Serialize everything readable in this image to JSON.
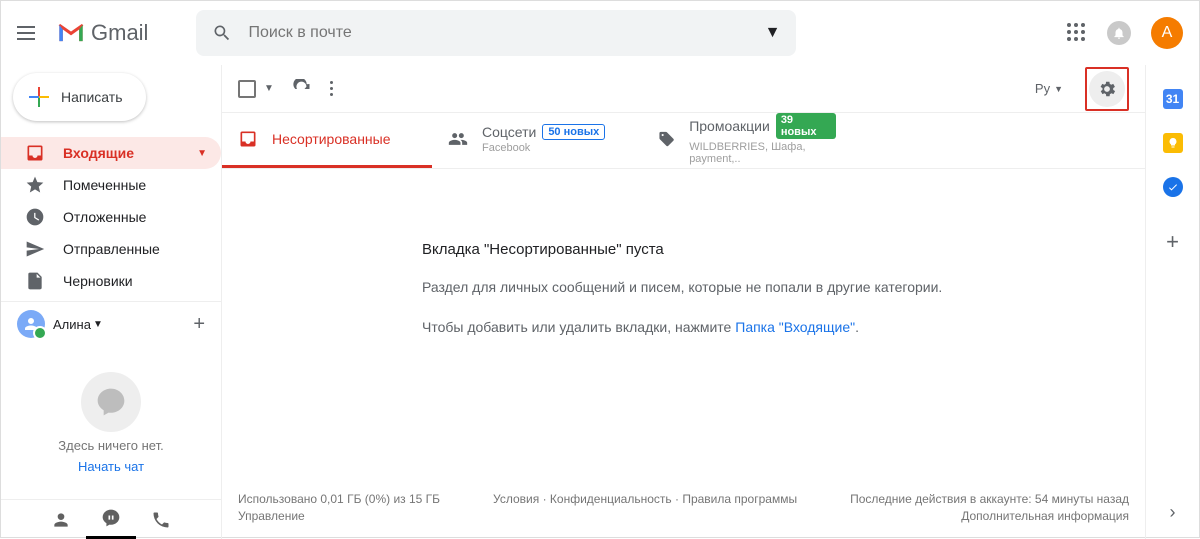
{
  "header": {
    "app_name": "Gmail",
    "search_placeholder": "Поиск в почте",
    "avatar_letter": "А"
  },
  "sidebar": {
    "compose": "Написать",
    "items": [
      {
        "label": "Входящие"
      },
      {
        "label": "Помеченные"
      },
      {
        "label": "Отложенные"
      },
      {
        "label": "Отправленные"
      },
      {
        "label": "Черновики"
      }
    ],
    "hangouts_user": "Алина",
    "hangouts_empty": "Здесь ничего нет.",
    "hangouts_start": "Начать чат"
  },
  "toolbar": {
    "lang": "Ру"
  },
  "tabs": [
    {
      "label": "Несортированные"
    },
    {
      "label": "Соцсети",
      "badge": "50 новых",
      "sub": "Facebook"
    },
    {
      "label": "Промоакции",
      "badge": "39 новых",
      "sub": "WILDBERRIES, Шафа, payment,.."
    }
  ],
  "content": {
    "heading": "Вкладка \"Несортированные\" пуста",
    "line1": "Раздел для личных сообщений и писем, которые не попали в другие категории.",
    "line2_pre": "Чтобы добавить или удалить вкладки, нажмите ",
    "line2_link": "Папка \"Входящие\"",
    "line2_post": "."
  },
  "footer": {
    "storage": "Использовано 0,01 ГБ (0%) из 15 ГБ",
    "manage": "Управление",
    "terms": "Условия",
    "privacy": "Конфиденциальность",
    "policies": "Правила программы",
    "activity": "Последние действия в аккаунте: 54 минуты назад",
    "details": "Дополнительная информация"
  },
  "rightbar": {
    "calendar": "31"
  }
}
